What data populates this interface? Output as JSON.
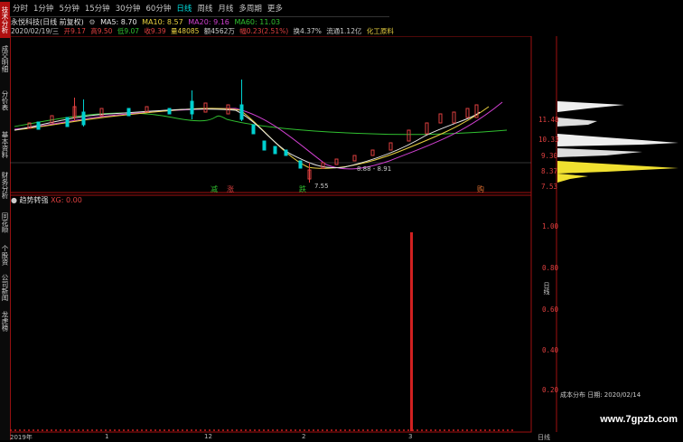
{
  "toolbar": {
    "items": [
      "分时",
      "1分钟",
      "5分钟",
      "15分钟",
      "30分钟",
      "60分钟",
      "日线",
      "周线",
      "月线",
      "多周期",
      "更多"
    ],
    "active_index": 6
  },
  "left_tabs": [
    "技术分析",
    "成交明细",
    "分价表",
    "基本资料",
    "财务分析",
    "同花顺F10",
    "个股资讯",
    "公司新闻",
    "龙虎榜"
  ],
  "header": {
    "stock_name": "永悦科技(日线 前复权)",
    "ma5": "MA5: 8.70",
    "ma10": "MA10: 8.57",
    "ma20": "MA20: 9.16",
    "ma60": "MA60: 11.03",
    "date": "2020/02/19/三",
    "open": "开9.17",
    "high": "高9.50",
    "low": "低9.07",
    "close": "收9.39",
    "volume": "量48085",
    "amount": "额4562万",
    "change": "幅0.23(2.51%)",
    "turnover": "换4.37%",
    "float": "流通1.12亿",
    "industry": "化工原料"
  },
  "main_chart": {
    "y_labels": [
      "11.48",
      "10.33",
      "9.30",
      "8.37",
      "7.53"
    ],
    "annotations": {
      "low_marker": "7.55",
      "range_marker": "8.88 - 8.91"
    },
    "signals": [
      {
        "label": "减",
        "color": "#30c030"
      },
      {
        "label": "涨",
        "color": "#e04040"
      },
      {
        "label": "跌",
        "color": "#30c030"
      },
      {
        "label": "购",
        "color": "#e07030"
      }
    ]
  },
  "sub_chart": {
    "title": "趋势转强",
    "value_label": "XG: 0.00",
    "y_labels": [
      "1.00",
      "0.80",
      "0.60",
      "0.40",
      "0.20"
    ],
    "side_label": "日线"
  },
  "chip_panel": {
    "label": "成本分布 日期: 2020/02/14"
  },
  "bottom_bar": {
    "date_label": "2019年",
    "marks": [
      "1",
      "12",
      "2",
      "3"
    ],
    "right_label": "日线"
  },
  "watermark": "www.7gpzb.com",
  "colors": {
    "ma5": "#e8e8e8",
    "ma10": "#e8d040",
    "ma20": "#d040d0",
    "ma60": "#30c030",
    "up": "#e04040",
    "down": "#00d0d0",
    "grid_border": "#a01010"
  }
}
